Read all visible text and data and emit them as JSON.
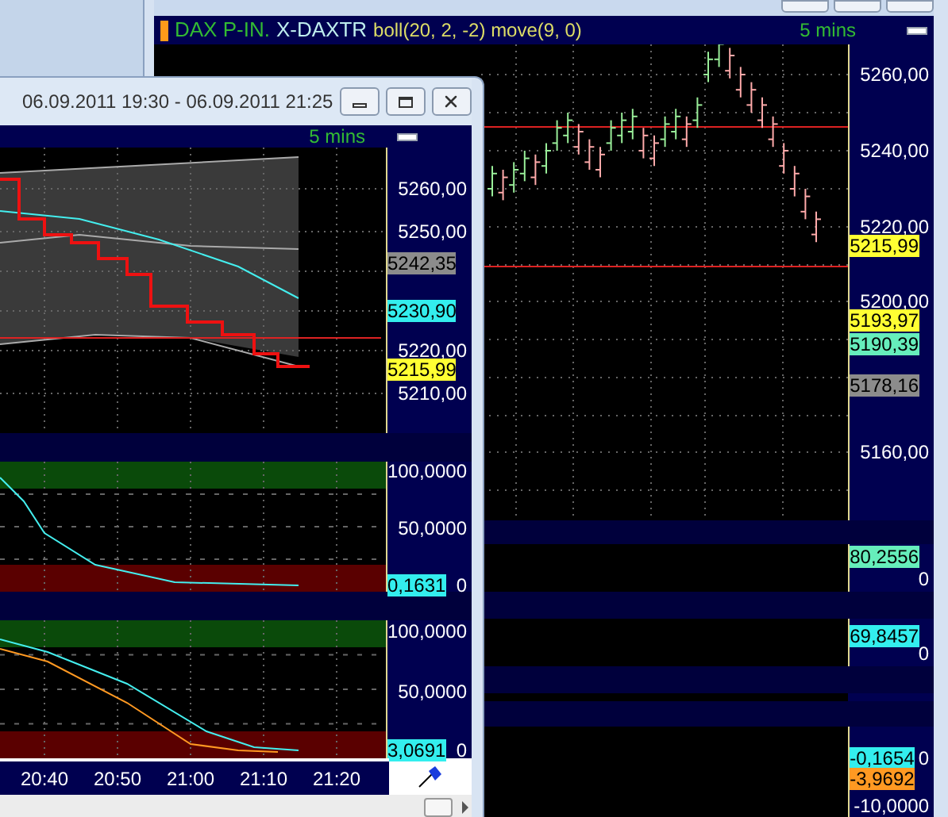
{
  "back_window": {
    "header": {
      "instrument": "DAX P-IN.",
      "symbol": "X-DAXTR",
      "indicators": "boll(20, 2, -2) move(9, 0)",
      "interval": "5 mins"
    },
    "price_axis": {
      "ticks": [
        "5260,00",
        "5240,00",
        "5220,00",
        "5200,00",
        "5160,00"
      ],
      "markers": [
        {
          "value": "5215,99",
          "color": "#ffff33"
        },
        {
          "value": "5193,97",
          "color": "#ffff33"
        },
        {
          "value": "5190,39",
          "color": "#66eebb"
        },
        {
          "value": "5178,16",
          "color": "#8c8c8c"
        }
      ]
    },
    "panels": [
      {
        "ticks": [
          "0"
        ],
        "markers": [
          {
            "value": "80,2556",
            "color": "#66eebb"
          }
        ]
      },
      {
        "ticks": [
          "0"
        ],
        "markers": [
          {
            "value": "69,8457",
            "color": "#33eeee"
          }
        ]
      },
      {
        "ticks": [
          "0",
          "-10,0000"
        ],
        "markers": [
          {
            "value": "-0,1654",
            "color": "#33eeee"
          },
          {
            "value": "-3,9692",
            "color": "#ff9922"
          }
        ]
      }
    ]
  },
  "front_window": {
    "title": "06.09.2011 19:30 - 06.09.2011 21:25",
    "header": {
      "interval": "5 mins"
    },
    "price_axis": {
      "ticks": [
        "5260,00",
        "5250,00",
        "5220,00",
        "5210,00"
      ],
      "markers": [
        {
          "value": "5242,35",
          "color": "#8c8c8c"
        },
        {
          "value": "5230,90",
          "color": "#33eeee"
        },
        {
          "value": "5215,99",
          "color": "#ffff33"
        }
      ]
    },
    "oscillators": [
      {
        "ticks": [
          "100,0000",
          "50,0000",
          "0"
        ],
        "markers": [
          {
            "value": "0,1631",
            "color": "#33eeee"
          }
        ]
      },
      {
        "ticks": [
          "100,0000",
          "50,0000",
          "0"
        ],
        "markers": [
          {
            "value": "3,0691",
            "color": "#33eeee"
          }
        ]
      }
    ],
    "time_axis": [
      "20:40",
      "20:50",
      "21:00",
      "21:10",
      "21:20"
    ]
  }
}
